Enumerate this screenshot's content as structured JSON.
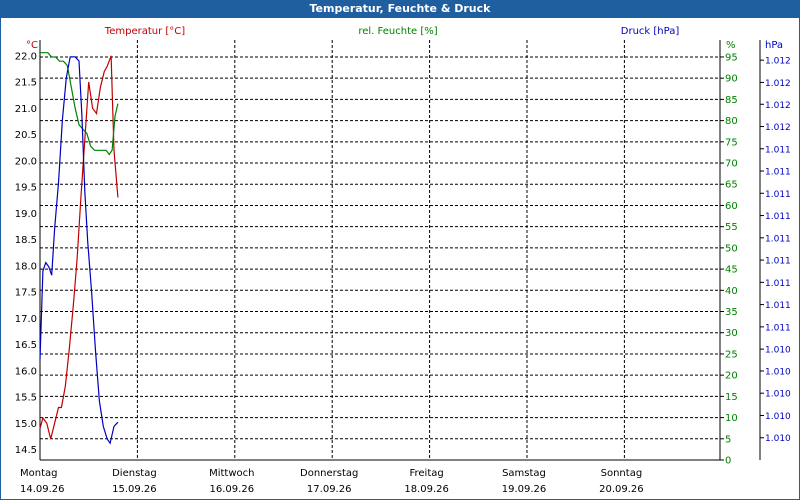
{
  "window": {
    "title": "Temperatur, Feuchte & Druck"
  },
  "colors": {
    "titlebar": "#1f5f9f",
    "temperature": "#c00000",
    "humidity": "#008000",
    "pressure": "#0000c0",
    "grid": "#000000"
  },
  "chart_data": {
    "type": "line",
    "title": "Temperatur, Feuchte & Druck",
    "grid": true,
    "x_labels": [
      {
        "day": "Montag",
        "date": "14.09.26"
      },
      {
        "day": "Dienstag",
        "date": "15.09.26"
      },
      {
        "day": "Mittwoch",
        "date": "16.09.26"
      },
      {
        "day": "Donnerstag",
        "date": "17.09.26"
      },
      {
        "day": "Freitag",
        "date": "18.09.26"
      },
      {
        "day": "Samstag",
        "date": "19.09.26"
      },
      {
        "day": "Sonntag",
        "date": "20.09.26"
      }
    ],
    "xlim": [
      0,
      7
    ],
    "axes": {
      "temperature": {
        "label": "Temperatur [°C]",
        "unit": "°C",
        "ylim": [
          14.3,
          22.3
        ],
        "ticks": [
          "22.0",
          "21.5",
          "21.0",
          "20.5",
          "20.0",
          "19.5",
          "19.0",
          "18.5",
          "18.0",
          "17.5",
          "17.0",
          "16.5",
          "16.0",
          "15.5",
          "15.0",
          "14.5"
        ],
        "tick_values": [
          22.0,
          21.5,
          21.0,
          20.5,
          20.0,
          19.5,
          19.0,
          18.5,
          18.0,
          17.5,
          17.0,
          16.5,
          16.0,
          15.5,
          15.0,
          14.5
        ]
      },
      "humidity": {
        "label": "rel. Feuchte [%]",
        "unit": "%",
        "ylim": [
          0,
          99
        ],
        "ticks": [
          "95",
          "90",
          "85",
          "80",
          "75",
          "70",
          "65",
          "60",
          "55",
          "50",
          "45",
          "40",
          "35",
          "30",
          "25",
          "20",
          "15",
          "10",
          "5",
          "0"
        ],
        "tick_values": [
          95,
          90,
          85,
          80,
          75,
          70,
          65,
          60,
          55,
          50,
          45,
          40,
          35,
          30,
          25,
          20,
          15,
          10,
          5,
          0
        ]
      },
      "pressure": {
        "label": "Druck [hPa]",
        "unit": "hPa",
        "ticks": [
          "1.012",
          "1.012",
          "1.012",
          "1.012",
          "1.011",
          "1.011",
          "1.011",
          "1.011",
          "1.011",
          "1.011",
          "1.011",
          "1.011",
          "1.011",
          "1.010",
          "1.010",
          "1.010",
          "1.010",
          "1.010"
        ],
        "ylim": [
          0,
          1
        ],
        "tick_positions": [
          0.952,
          0.899,
          0.847,
          0.794,
          0.741,
          0.688,
          0.635,
          0.582,
          0.529,
          0.476,
          0.423,
          0.37,
          0.317,
          0.264,
          0.212,
          0.159,
          0.106,
          0.053
        ]
      }
    },
    "series": [
      {
        "name": "Temperatur [°C]",
        "axis": "temperature",
        "x": [
          0.0,
          0.03,
          0.07,
          0.11,
          0.15,
          0.19,
          0.22,
          0.26,
          0.3,
          0.34,
          0.38,
          0.42,
          0.46,
          0.5,
          0.54,
          0.58,
          0.62,
          0.66,
          0.69,
          0.73,
          0.76,
          0.8
        ],
        "y": [
          14.9,
          15.1,
          15.0,
          14.7,
          15.0,
          15.3,
          15.3,
          15.7,
          16.4,
          17.2,
          18.1,
          19.3,
          20.4,
          21.5,
          21.0,
          20.9,
          21.4,
          21.7,
          21.8,
          22.0,
          20.2,
          19.3
        ]
      },
      {
        "name": "rel. Feuchte [%]",
        "axis": "humidity",
        "x": [
          0.0,
          0.04,
          0.08,
          0.12,
          0.16,
          0.2,
          0.24,
          0.28,
          0.32,
          0.36,
          0.4,
          0.44,
          0.48,
          0.52,
          0.56,
          0.6,
          0.64,
          0.68,
          0.71,
          0.74,
          0.77,
          0.8
        ],
        "y": [
          96,
          96,
          96,
          95,
          95,
          94,
          94,
          93,
          88,
          83,
          79,
          78,
          77,
          74,
          73,
          73,
          73,
          73,
          72,
          73,
          81,
          84
        ]
      },
      {
        "name": "Druck [hPa]",
        "axis": "pressure",
        "x": [
          0.0,
          0.03,
          0.06,
          0.09,
          0.12,
          0.15,
          0.19,
          0.23,
          0.27,
          0.31,
          0.36,
          0.4,
          0.43,
          0.46,
          0.49,
          0.53,
          0.57,
          0.61,
          0.65,
          0.69,
          0.72,
          0.76,
          0.8
        ],
        "y": [
          0.24,
          0.45,
          0.47,
          0.46,
          0.44,
          0.55,
          0.66,
          0.81,
          0.91,
          0.96,
          0.96,
          0.95,
          0.82,
          0.64,
          0.52,
          0.4,
          0.26,
          0.14,
          0.08,
          0.05,
          0.04,
          0.08,
          0.09
        ]
      }
    ]
  }
}
